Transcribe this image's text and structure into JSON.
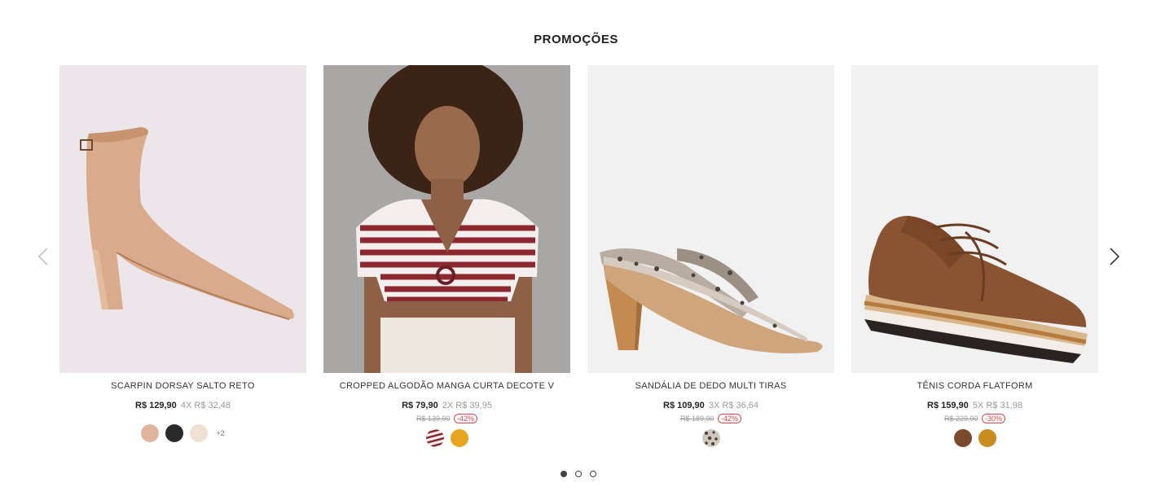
{
  "section": {
    "title": "PROMOÇÕES"
  },
  "nav": {
    "prev_icon": "chevron-left-icon",
    "next_icon": "chevron-right-icon"
  },
  "products": [
    {
      "name": "SCARPIN DORSAY SALTO RETO",
      "price": "R$ 129,90",
      "installments": "4X R$ 32,48",
      "old_price": "",
      "discount": "",
      "image_bg": "#ece6ea",
      "swatches": [
        "#dfb59e",
        "#2a2a2a",
        "#efe2d2"
      ],
      "more_colors": "+2"
    },
    {
      "name": "CROPPED ALGODÃO MANGA CURTA DECOTE V",
      "price": "R$ 79,90",
      "installments": "2X R$ 39,95",
      "old_price": "R$ 139,90",
      "discount": "-42%",
      "image_bg": "#a9a6a6",
      "swatches": [
        "stripes-red",
        "#e8a521"
      ],
      "more_colors": ""
    },
    {
      "name": "SANDÁLIA DE DEDO MULTI TIRAS",
      "price": "R$ 109,90",
      "installments": "3X R$ 36,64",
      "old_price": "R$ 189,90",
      "discount": "-42%",
      "image_bg": "#f1f1f1",
      "swatches": [
        "snake-print"
      ],
      "more_colors": ""
    },
    {
      "name": "TÊNIS CORDA FLATFORM",
      "price": "R$ 159,90",
      "installments": "5X R$ 31,98",
      "old_price": "R$ 229,90",
      "discount": "-30%",
      "image_bg": "#f1f1f1",
      "swatches": [
        "#7b4a2c",
        "#c98c1f"
      ],
      "more_colors": ""
    }
  ],
  "pagination": {
    "pages": 3,
    "active": 1
  }
}
